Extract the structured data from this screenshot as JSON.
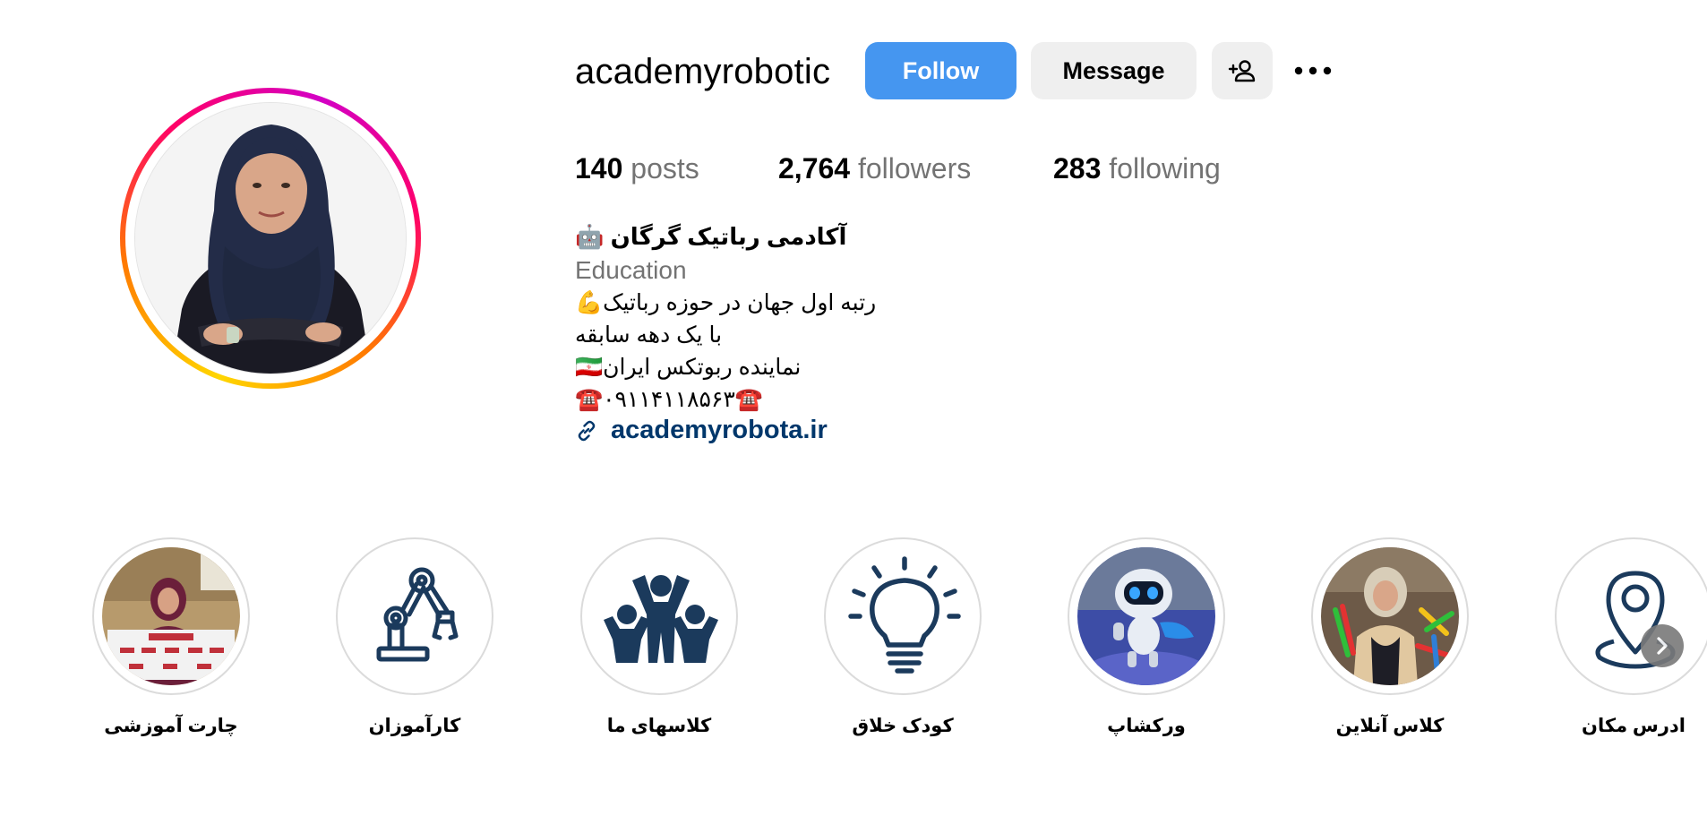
{
  "profile": {
    "username": "academyrobotic",
    "follow_label": "Follow",
    "message_label": "Message",
    "add_user_icon": "add-user-icon",
    "more_icon": "more-options-icon"
  },
  "stats": {
    "posts_count": "140",
    "posts_label": "posts",
    "followers_count": "2,764",
    "followers_label": "followers",
    "following_count": "283",
    "following_label": "following"
  },
  "bio": {
    "name": "🤖 آکادمی رباتیک گرگان",
    "category": "Education",
    "lines": [
      "💪رتبه اول جهان در حوزه رباتیک",
      "با یک دهه سابقه",
      "🇮🇷نماینده ربوتکس ایران",
      "☎️۰۹۱۱۴۱۱۸۵۶۳☎️"
    ],
    "link_icon": "link-icon",
    "link": "academyrobota.ir"
  },
  "highlights": [
    {
      "label": "چارت آموزشی",
      "type": "photo"
    },
    {
      "label": "کارآموزان",
      "type": "icon",
      "icon": "robot-arm-icon"
    },
    {
      "label": "کلاسهای ما",
      "type": "icon",
      "icon": "people-group-icon"
    },
    {
      "label": "کودک خلاق",
      "type": "icon",
      "icon": "lightbulb-icon"
    },
    {
      "label": "ورکشاپ",
      "type": "photo"
    },
    {
      "label": "کلاس آنلاین",
      "type": "photo"
    },
    {
      "label": "ادرس مکان",
      "type": "icon",
      "icon": "location-pin-icon"
    }
  ],
  "colors": {
    "follow_button": "#4596f0",
    "link": "#00376b",
    "icon_navy": "#1b3a5c",
    "secondary_text": "#737373"
  }
}
